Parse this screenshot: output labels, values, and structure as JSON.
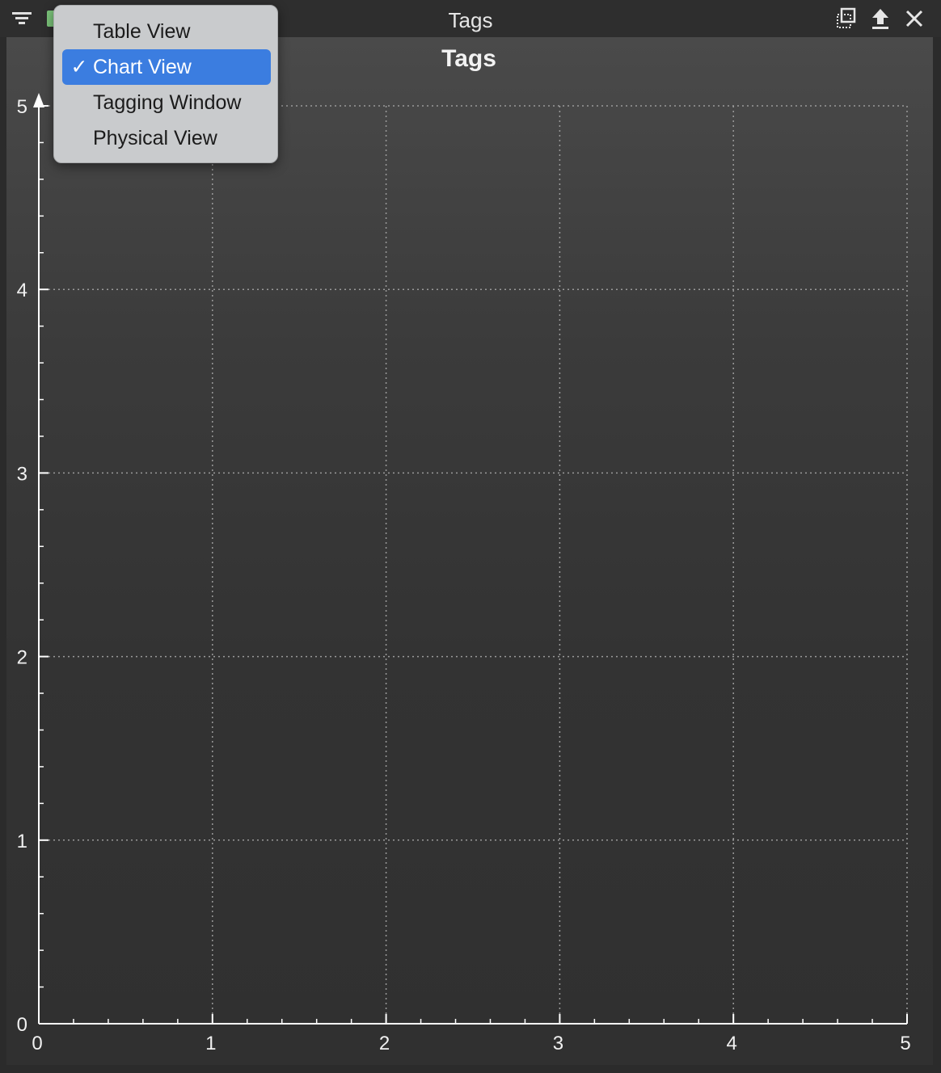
{
  "window": {
    "title": "Tags"
  },
  "menu": {
    "items": [
      {
        "label": "Table View",
        "checked": false
      },
      {
        "label": "Chart View",
        "checked": true
      },
      {
        "label": "Tagging Window",
        "checked": false
      },
      {
        "label": "Physical View",
        "checked": false
      }
    ],
    "check_glyph": "✓",
    "selected_color": "#3b7de0"
  },
  "icons": {
    "filter": "filter-icon",
    "float": "float-window-icon",
    "upload": "upload-icon",
    "close": "close-icon"
  },
  "chart_data": {
    "type": "scatter",
    "title": "Tags",
    "xlabel": "",
    "ylabel": "",
    "xlim": [
      0,
      5
    ],
    "ylim": [
      0,
      5
    ],
    "x_ticks": [
      0,
      1,
      2,
      3,
      4,
      5
    ],
    "y_ticks": [
      0,
      1,
      2,
      3,
      4,
      5
    ],
    "grid": true,
    "series": []
  }
}
